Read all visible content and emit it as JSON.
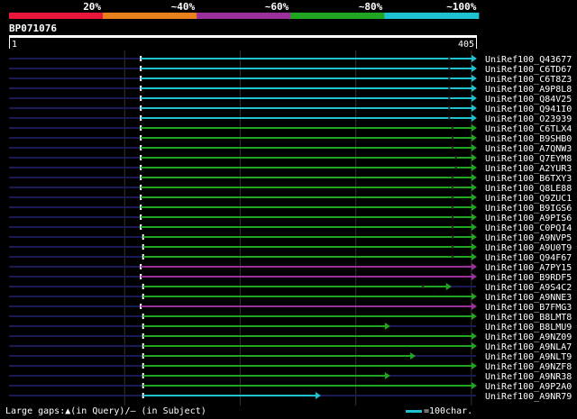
{
  "query": {
    "id": "BP071076",
    "start": "1",
    "end": "405",
    "length": 405
  },
  "colors": {
    "background": "#000000",
    "query_line_bg": "#1a1a55",
    "lt20": "#e8173a",
    "p40": "#e8801b",
    "p60": "#9b2f9b",
    "p80": "#1fa51f",
    "p100": "#1ec1cf"
  },
  "identity_legend": [
    {
      "label": "20%",
      "color": "#e8173a"
    },
    {
      "label": "~40%",
      "color": "#e8801b"
    },
    {
      "label": "~60%",
      "color": "#9b2f9b"
    },
    {
      "label": "~80%",
      "color": "#1fa51f"
    },
    {
      "label": "~100%",
      "color": "#1ec1cf"
    }
  ],
  "hits": [
    {
      "name": "UniRef100_Q43677",
      "start": 115,
      "end": 405,
      "color": "p100",
      "gap": 0.92
    },
    {
      "name": "UniRef100_C6TD67",
      "start": 115,
      "end": 405,
      "color": "p100",
      "gap": 0.92
    },
    {
      "name": "UniRef100_C6T8Z3",
      "start": 115,
      "end": 405,
      "color": "p100",
      "gap": 0.92
    },
    {
      "name": "UniRef100_A9P8L8",
      "start": 115,
      "end": 405,
      "color": "p100",
      "gap": 0.92
    },
    {
      "name": "UniRef100_Q84V25",
      "start": 115,
      "end": 405,
      "color": "p100",
      "gap": 0.92
    },
    {
      "name": "UniRef100_Q941I0",
      "start": 115,
      "end": 405,
      "color": "p100",
      "gap": 0.92
    },
    {
      "name": "UniRef100_O23939",
      "start": 115,
      "end": 405,
      "color": "p100",
      "gap": 0.92
    },
    {
      "name": "UniRef100_C6TLX4",
      "start": 115,
      "end": 405,
      "color": "p80",
      "gap": 0.93
    },
    {
      "name": "UniRef100_B9SHB0",
      "start": 115,
      "end": 405,
      "color": "p80",
      "gap": 0.93
    },
    {
      "name": "UniRef100_A7QNW3",
      "start": 115,
      "end": 405,
      "color": "p80",
      "gap": 0.93
    },
    {
      "name": "UniRef100_Q7EYM8",
      "start": 115,
      "end": 405,
      "color": "p80",
      "gap": 0.94
    },
    {
      "name": "UniRef100_A2YUR3",
      "start": 115,
      "end": 405,
      "color": "p80",
      "gap": 0.94
    },
    {
      "name": "UniRef100_B6TXY3",
      "start": 115,
      "end": 405,
      "color": "p80",
      "gap": 0.93
    },
    {
      "name": "UniRef100_Q8LE88",
      "start": 115,
      "end": 405,
      "color": "p80",
      "gap": 0.93
    },
    {
      "name": "UniRef100_Q9ZUC1",
      "start": 115,
      "end": 405,
      "color": "p80",
      "gap": 0.93
    },
    {
      "name": "UniRef100_B9IGS6",
      "start": 115,
      "end": 405,
      "color": "p80",
      "gap": 0.93
    },
    {
      "name": "UniRef100_A9PIS6",
      "start": 115,
      "end": 405,
      "color": "p80",
      "gap": 0.93
    },
    {
      "name": "UniRef100_C0PQI4",
      "start": 115,
      "end": 405,
      "color": "p80",
      "gap": 0.93
    },
    {
      "name": "UniRef100_A9NVP5",
      "start": 117,
      "end": 405,
      "color": "p80",
      "gap": 0.93
    },
    {
      "name": "UniRef100_A9U0T9",
      "start": 117,
      "end": 405,
      "color": "p80",
      "gap": 0.93
    },
    {
      "name": "UniRef100_Q94F67",
      "start": 117,
      "end": 405,
      "color": "p80",
      "gap": 0.93
    },
    {
      "name": "UniRef100_A7PY15",
      "start": 115,
      "end": 405,
      "color": "p60",
      "gap": 0
    },
    {
      "name": "UniRef100_B9RDF5",
      "start": 115,
      "end": 405,
      "color": "p60",
      "gap": 0
    },
    {
      "name": "UniRef100_A9S4C2",
      "start": 117,
      "end": 383,
      "color": "p80",
      "gap": 0.91
    },
    {
      "name": "UniRef100_A9NNE3",
      "start": 117,
      "end": 405,
      "color": "p80",
      "gap": 0
    },
    {
      "name": "UniRef100_B7FMG3",
      "start": 115,
      "end": 405,
      "color": "p60",
      "gap": 0
    },
    {
      "name": "UniRef100_B8LMT8",
      "start": 117,
      "end": 405,
      "color": "p80",
      "gap": 0
    },
    {
      "name": "UniRef100_B8LMU9",
      "start": 117,
      "end": 330,
      "color": "p80",
      "gap": 0
    },
    {
      "name": "UniRef100_A9NZ09",
      "start": 117,
      "end": 405,
      "color": "p80",
      "gap": 0
    },
    {
      "name": "UniRef100_A9NLA7",
      "start": 117,
      "end": 405,
      "color": "p80",
      "gap": 0
    },
    {
      "name": "UniRef100_A9NLT9",
      "start": 117,
      "end": 352,
      "color": "p80",
      "gap": 0
    },
    {
      "name": "UniRef100_A9NZF8",
      "start": 117,
      "end": 405,
      "color": "p80",
      "gap": 0
    },
    {
      "name": "UniRef100_A9NR38",
      "start": 117,
      "end": 330,
      "color": "p80",
      "gap": 0
    },
    {
      "name": "UniRef100_A9P2A0",
      "start": 117,
      "end": 405,
      "color": "p80",
      "gap": 0
    },
    {
      "name": "UniRef100_A9NR79",
      "start": 117,
      "end": 270,
      "color": "p100",
      "gap": 0
    }
  ],
  "footer": {
    "large_gaps": "Large gaps:▲(in Query)/– (in Subject)",
    "scale": "=100char."
  }
}
